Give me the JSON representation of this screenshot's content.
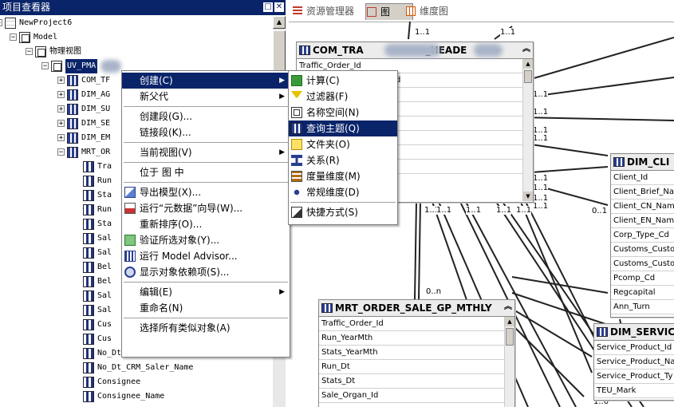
{
  "explorer": {
    "title": "项目查看器",
    "minimize": "□",
    "close": "✕",
    "tree": [
      {
        "label": "NewProject6",
        "level": 0,
        "icon": "project-icon",
        "exp": "−"
      },
      {
        "label": "Model",
        "level": 1,
        "icon": "namespace-icon",
        "exp": "−"
      },
      {
        "label": "物理视图",
        "level": 2,
        "icon": "namespace-icon",
        "exp": "−"
      },
      {
        "label": "UV_PMA",
        "level": 3,
        "icon": "namespace-icon",
        "exp": "−",
        "selected": true
      },
      {
        "label": "COM_TF",
        "level": 4,
        "icon": "query-subject-icon",
        "exp": "+"
      },
      {
        "label": "DIM_AG",
        "level": 4,
        "icon": "query-subject-icon",
        "exp": "+"
      },
      {
        "label": "DIM_SU",
        "level": 4,
        "icon": "query-subject-icon",
        "exp": "+"
      },
      {
        "label": "DIM_SE",
        "level": 4,
        "icon": "query-subject-icon",
        "exp": "+"
      },
      {
        "label": "DIM_EM",
        "level": 4,
        "icon": "query-subject-icon",
        "exp": "+"
      },
      {
        "label": "MRT_OR",
        "level": 4,
        "icon": "query-subject-icon",
        "exp": "−"
      },
      {
        "label": "Tra",
        "level": 5,
        "icon": "query-item-icon"
      },
      {
        "label": "Run",
        "level": 5,
        "icon": "query-item-icon"
      },
      {
        "label": "Sta",
        "level": 5,
        "icon": "query-item-icon"
      },
      {
        "label": "Run",
        "level": 5,
        "icon": "query-item-icon"
      },
      {
        "label": "Sta",
        "level": 5,
        "icon": "query-item-icon"
      },
      {
        "label": "Sal",
        "level": 5,
        "icon": "query-item-icon"
      },
      {
        "label": "Sal",
        "level": 5,
        "icon": "query-item-icon"
      },
      {
        "label": "Bel",
        "level": 5,
        "icon": "query-item-icon"
      },
      {
        "label": "Bel",
        "level": 5,
        "icon": "query-item-icon"
      },
      {
        "label": "Sal",
        "level": 5,
        "icon": "query-item-icon"
      },
      {
        "label": "Sal",
        "level": 5,
        "icon": "query-item-icon"
      },
      {
        "label": "Cus",
        "level": 5,
        "icon": "query-item-icon"
      },
      {
        "label": "Cus",
        "level": 5,
        "icon": "query-item-icon"
      },
      {
        "label": "No_Dt_CRM_Saler",
        "level": 5,
        "icon": "query-item-icon"
      },
      {
        "label": "No_Dt_CRM_Saler_Name",
        "level": 5,
        "icon": "query-item-icon"
      },
      {
        "label": "Consignee",
        "level": 5,
        "icon": "query-item-icon"
      },
      {
        "label": "Consignee_Name",
        "level": 5,
        "icon": "query-item-icon"
      }
    ]
  },
  "tabs": [
    {
      "label": "资源管理器",
      "icon": "explorer-icon",
      "active": false
    },
    {
      "label": "图",
      "icon": "diagram-icon",
      "active": true
    },
    {
      "label": "维度图",
      "icon": "dimension-diagram-icon",
      "active": false
    }
  ],
  "diagram": {
    "com_table": {
      "title_a": "COM_TRA",
      "title_b": "_HEADE",
      "rows": [
        "Traffic_Order_Id",
        "d",
        "",
        "",
        "",
        "",
        "",
        ""
      ]
    },
    "mrt_table": {
      "title": "MRT_ORDER_SALE_GP_MTHLY",
      "rows": [
        "Traffic_Order_Id",
        "Run_YearMth",
        "Stats_YearMth",
        "Run_Dt",
        "Stats_Dt",
        "Sale_Organ_Id"
      ]
    },
    "dim_cli_table": {
      "title": "DIM_CLI",
      "rows": [
        "Client_Id",
        "Client_Brief_Na",
        "Client_CN_Nam",
        "Client_EN_Nam",
        "Corp_Type_Cd",
        "Customs_Custo",
        "Customs_Custo",
        "Pcomp_Cd",
        "Regcapital",
        "Ann_Turn"
      ]
    },
    "dim_service_table": {
      "title": "DIM_SERVIC",
      "rows": [
        "Service_Product_Id",
        "Service_Product_Na",
        "Service_Product_Ty",
        "TEU_Mark"
      ]
    },
    "cardinalities": [
      "1..1",
      "1..1",
      "1..1",
      "1..1",
      "1..1",
      "1..1",
      "1..1",
      "1..1",
      "1..1",
      "1..1",
      "1..1",
      "1..1",
      "1..1",
      "1..1",
      "1..1",
      "0..1",
      "0..n",
      "1..0"
    ]
  },
  "context_menu": {
    "items": [
      {
        "label": "创建(C)",
        "submenu": true,
        "highlighted": true
      },
      {
        "label": "新父代",
        "submenu": true
      },
      {
        "sep": true
      },
      {
        "label": "创建段(G)..."
      },
      {
        "label": "链接段(K)..."
      },
      {
        "sep": true
      },
      {
        "label": "当前视图(V)",
        "submenu": true
      },
      {
        "sep": true
      },
      {
        "label": "位于 图 中"
      },
      {
        "sep": true
      },
      {
        "label": "导出模型(X)...",
        "icon": "export-icon"
      },
      {
        "label": "运行“元数据”向导(W)...",
        "icon": "wizard-icon"
      },
      {
        "label": "重新排序(O)..."
      },
      {
        "label": "验证所选对象(Y)...",
        "icon": "verify-icon"
      },
      {
        "label": "运行 Model Advisor...",
        "icon": "advisor-icon"
      },
      {
        "label": "显示对象依赖项(S)...",
        "icon": "dependency-icon"
      },
      {
        "sep": true
      },
      {
        "label": "编辑(E)",
        "submenu": true
      },
      {
        "label": "重命名(N)"
      },
      {
        "sep": true
      },
      {
        "label": "选择所有类似对象(A)"
      }
    ]
  },
  "submenu": {
    "items": [
      {
        "label": "计算(C)",
        "icon": "calculation-icon"
      },
      {
        "label": "过滤器(F)",
        "icon": "filter-icon"
      },
      {
        "label": "名称空间(N)",
        "icon": "namespace-icon"
      },
      {
        "label": "查询主题(Q)",
        "icon": "query-subject-icon",
        "highlighted": true
      },
      {
        "label": "文件夹(O)",
        "icon": "folder-icon"
      },
      {
        "label": "关系(R)",
        "icon": "relationship-icon"
      },
      {
        "label": "度量维度(M)",
        "icon": "measure-dimension-icon"
      },
      {
        "label": "常规维度(D)",
        "icon": "regular-dimension-icon"
      },
      {
        "sep": true
      },
      {
        "label": "快捷方式(S)",
        "icon": "shortcut-icon"
      }
    ]
  }
}
